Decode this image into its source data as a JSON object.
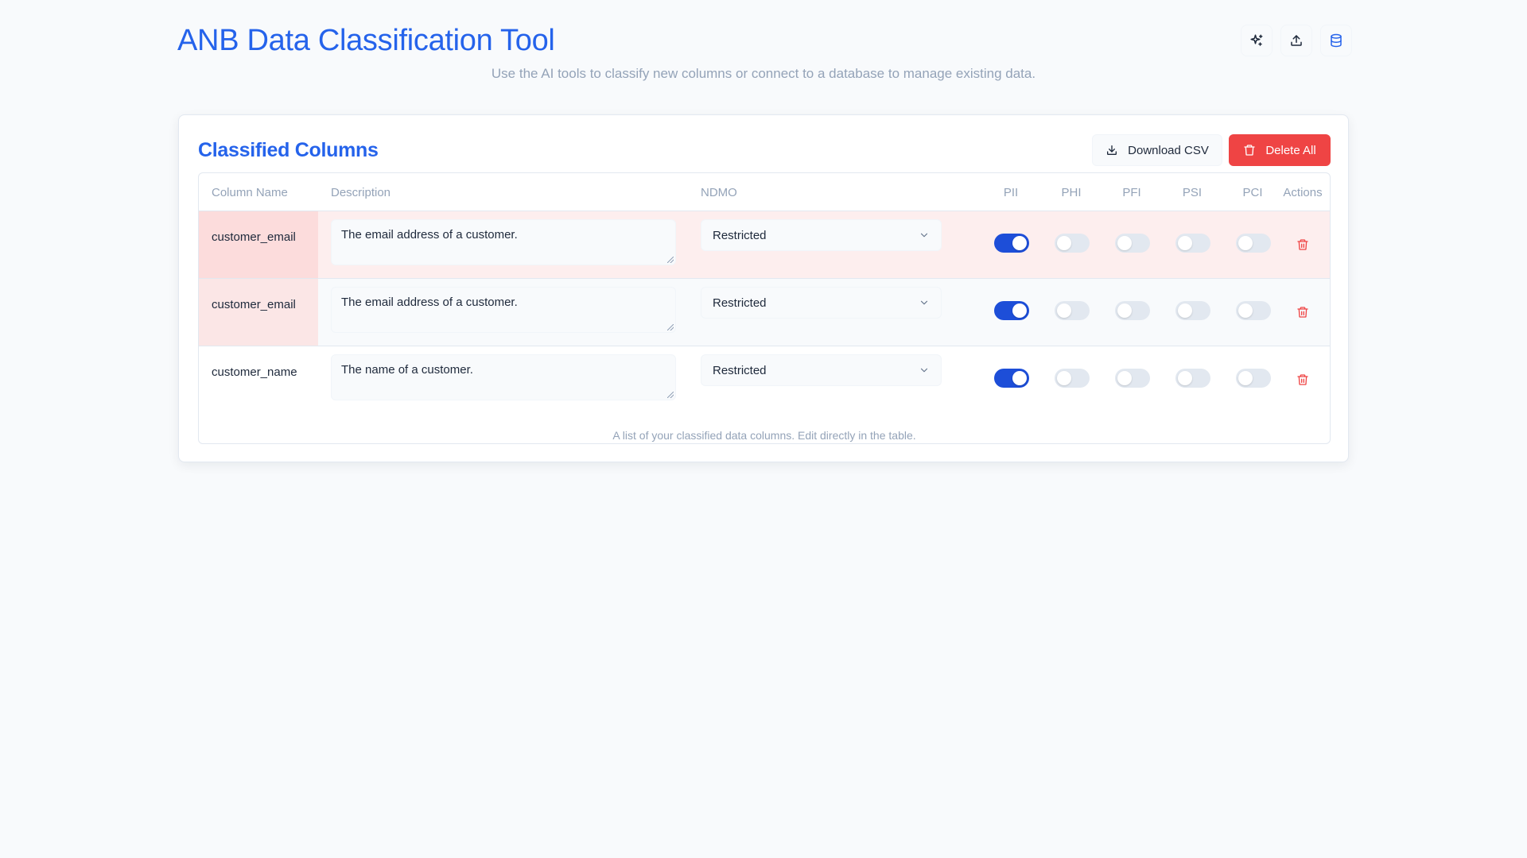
{
  "header": {
    "title": "ANB Data Classification Tool",
    "subtitle": "Use the AI tools to classify new columns or connect to a database to manage existing data.",
    "actions": [
      {
        "icon": "sparkles-icon"
      },
      {
        "icon": "upload-icon"
      },
      {
        "icon": "database-icon"
      }
    ]
  },
  "card": {
    "title": "Classified Columns",
    "download_label": "Download CSV",
    "delete_all_label": "Delete All",
    "caption": "A list of your classified data columns. Edit directly in the table."
  },
  "table": {
    "headers": {
      "column_name": "Column Name",
      "description": "Description",
      "ndmo": "NDMO",
      "pii": "PII",
      "phi": "PHI",
      "pfi": "PFI",
      "psi": "PSI",
      "pci": "PCI",
      "actions": "Actions"
    },
    "rows": [
      {
        "name": "customer_email",
        "description": "The email address of a customer.",
        "ndmo": "Restricted",
        "pii": true,
        "phi": false,
        "pfi": false,
        "psi": false,
        "pci": false
      },
      {
        "name": "customer_email",
        "description": "The email address of a customer.",
        "ndmo": "Restricted",
        "pii": true,
        "phi": false,
        "pfi": false,
        "psi": false,
        "pci": false
      },
      {
        "name": "customer_name",
        "description": "The name of a customer.",
        "ndmo": "Restricted",
        "pii": true,
        "phi": false,
        "pfi": false,
        "psi": false,
        "pci": false
      }
    ]
  },
  "colors": {
    "accent": "#2563eb",
    "toggle_on": "#1d4ed8",
    "danger": "#ef4444",
    "muted_text": "#94a3b8"
  }
}
